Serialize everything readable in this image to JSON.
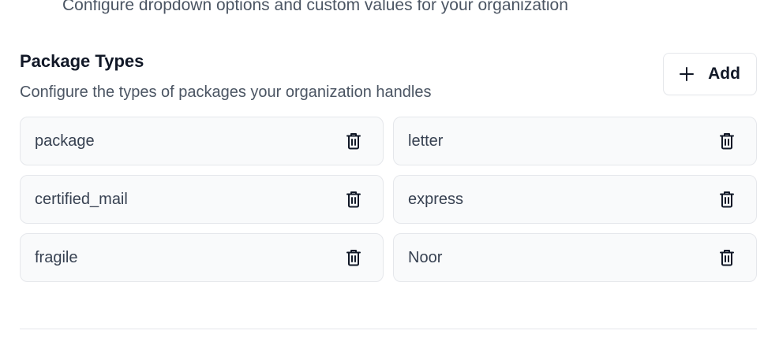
{
  "header": {
    "subtitle": "Configure dropdown options and custom values for your organization"
  },
  "section": {
    "title": "Package Types",
    "description": "Configure the types of packages your organization handles",
    "add_label": "Add",
    "items": [
      {
        "label": "package"
      },
      {
        "label": "letter"
      },
      {
        "label": "certified_mail"
      },
      {
        "label": "express"
      },
      {
        "label": "fragile"
      },
      {
        "label": "Noor"
      }
    ]
  },
  "icons": {
    "add": "plus-icon",
    "delete": "trash-icon"
  }
}
